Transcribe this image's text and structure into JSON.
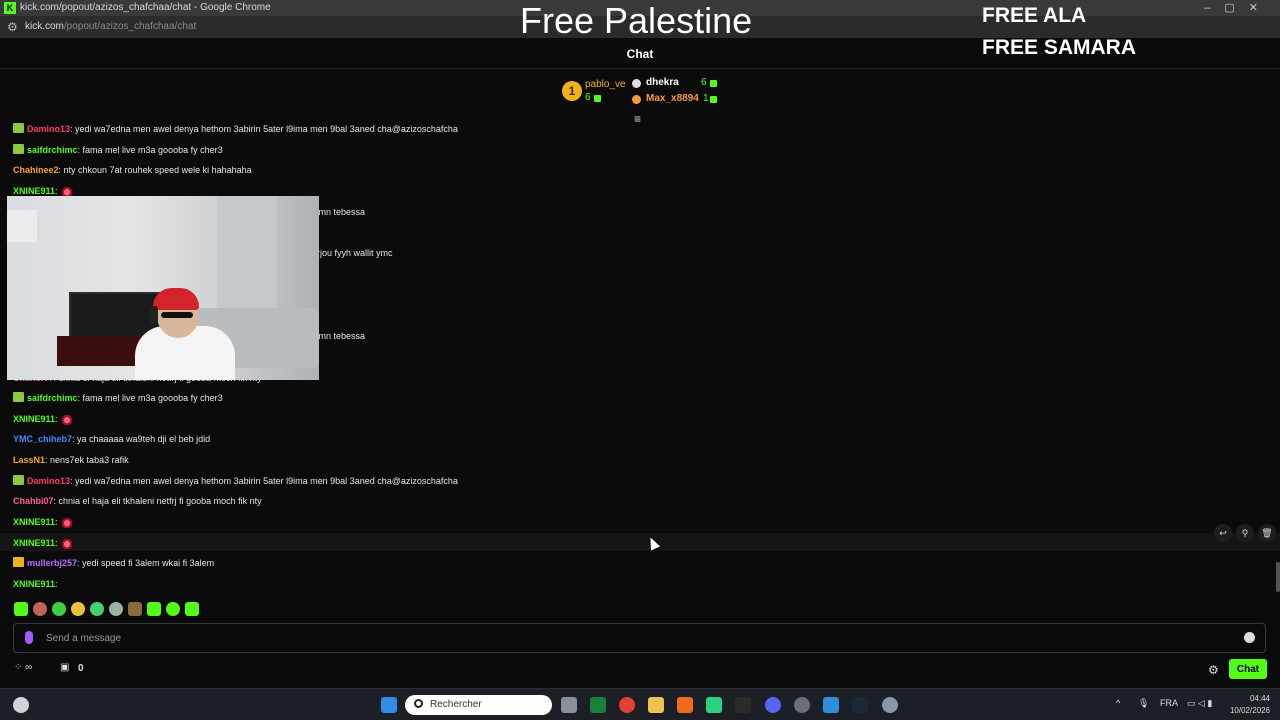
{
  "browser": {
    "window_title": "kick.com/popout/azizos_chafchaa/chat - Google Chrome",
    "url_host": "kick.com",
    "url_path": "/popout/azizos_chafchaa/chat"
  },
  "overlay": {
    "headline": "Free Palestine",
    "line1": "FREE ALA",
    "line2": "FREE SAMARA"
  },
  "chat": {
    "title": "Chat",
    "leaderboard": [
      {
        "rank": "1",
        "name": "pablo_ve",
        "count": "6",
        "color": "#f0b21b"
      },
      {
        "name": "dhekra",
        "count": "6",
        "color": "#ffffff"
      },
      {
        "name": "Max_x8894",
        "count": "1",
        "color": "#f59a3c"
      }
    ],
    "messages": [
      {
        "user": "Damino13",
        "text": ": yedi wa7edna men awel denya hethom 3abirin 5ater l9ima men 9bal 3aned cha@azizoschafcha",
        "color": "#ff3b5c",
        "badge": "#8dc63f"
      },
      {
        "user": "saifdrchimc",
        "text": ": fama mel live m3a goooba fy cher3",
        "color": "#53fc18",
        "badge": "#8dc63f"
      },
      {
        "user": "Chahinee2",
        "text": ": nty chkoun 7at rouhek speed wele ki hahahaha",
        "color": "#f5a623",
        "badge": ""
      },
      {
        "user": "XNINE911",
        "text": ":",
        "color": "#53fc18",
        "badge": "",
        "emote": true
      },
      {
        "user": "",
        "text": "a mn tebessa",
        "color": "#ffffff",
        "badge": "",
        "offset": 311
      },
      {
        "user": "",
        "text": "etfarjou fyyh wallit ymc",
        "color": "#ffffff",
        "badge": "",
        "offset": 302
      },
      {
        "user": "",
        "text": "a mn tebessa",
        "color": "#ffffff",
        "badge": "",
        "offset": 311
      },
      {
        "user": "Chahbi07",
        "text": ": chnia el haja eli tkhaleni netfrj fi gooba moch fik nty",
        "color": "#ff5fa2",
        "badge": ""
      },
      {
        "user": "saifdrchimc",
        "text": ": fama mel live m3a goooba fy cher3",
        "color": "#53fc18",
        "badge": "#8dc63f"
      },
      {
        "user": "XNINE911",
        "text": ":",
        "color": "#53fc18",
        "badge": "",
        "emote": true
      },
      {
        "user": "YMC_chiheb7",
        "text": ": ya chaaaaa wa9teh dji el beb jdid",
        "color": "#3f8cff",
        "badge": ""
      },
      {
        "user": "LassN1",
        "text": ": nens7ek taba3 rafik",
        "color": "#f5a623",
        "badge": ""
      },
      {
        "user": "Damino13",
        "text": ": yedi wa7edna men awel denya hethom 3abirin 5ater l9ima men 9bal 3aned cha@azizoschafcha",
        "color": "#ff3b5c",
        "badge": "#8dc63f"
      },
      {
        "user": "Chahbi07",
        "text": ": chnia el haja eli tkhaleni netfrj fi gooba moch fik nty",
        "color": "#ff5fa2",
        "badge": ""
      },
      {
        "user": "XNINE911",
        "text": ":",
        "color": "#53fc18",
        "badge": "",
        "emote": true
      },
      {
        "user": "XNINE911",
        "text": ":",
        "color": "#53fc18",
        "badge": "",
        "emote": true
      },
      {
        "user": "mullerbj257",
        "text": ": yedi speed fi 3alem wkai fi 3alem",
        "color": "#b86bff",
        "badge": "#f0b21b"
      },
      {
        "user": "XNINE911",
        "text": ":",
        "color": "#53fc18",
        "badge": "",
        "emote": false
      }
    ],
    "input_placeholder": "Send a message",
    "gift_count": "0",
    "chat_button": "Chat"
  },
  "taskbar": {
    "search_label": "Rechercher",
    "lang": "FRA",
    "time": "04:44",
    "date": "10/02/2026"
  },
  "colors": {
    "kick_green": "#53fc18",
    "background": "#0b0b0c"
  }
}
